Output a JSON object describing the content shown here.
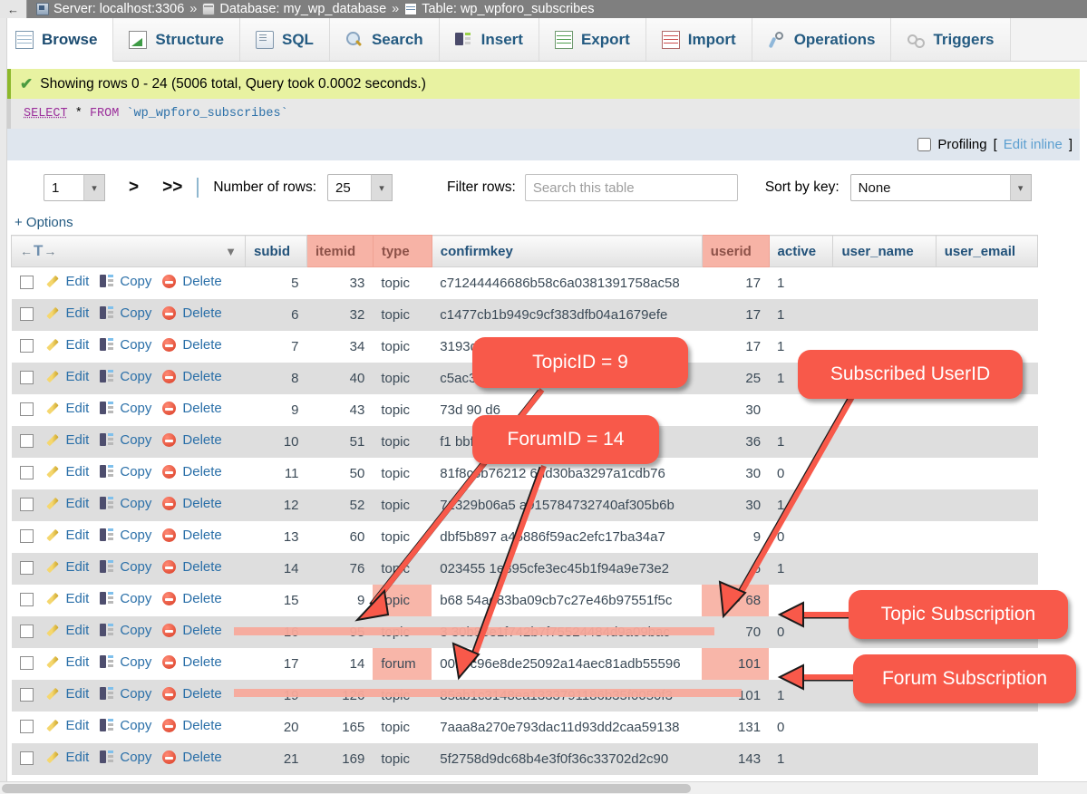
{
  "breadcrumb": {
    "back_icon": "back-arrow-icon",
    "server_icon": "server-icon",
    "server": "Server: localhost:3306",
    "sep1": "»",
    "database_icon": "database-icon",
    "database": "Database: my_wp_database",
    "sep2": "»",
    "table_icon": "table-icon",
    "table": "Table: wp_wpforo_subscribes"
  },
  "tabs": [
    {
      "label": "Browse",
      "icon": "browse-icon",
      "active": true
    },
    {
      "label": "Structure",
      "icon": "structure-icon",
      "active": false
    },
    {
      "label": "SQL",
      "icon": "sql-icon",
      "active": false
    },
    {
      "label": "Search",
      "icon": "search-icon",
      "active": false
    },
    {
      "label": "Insert",
      "icon": "insert-icon",
      "active": false
    },
    {
      "label": "Export",
      "icon": "export-icon",
      "active": false
    },
    {
      "label": "Import",
      "icon": "import-icon",
      "active": false
    },
    {
      "label": "Operations",
      "icon": "operations-icon",
      "active": false
    },
    {
      "label": "Triggers",
      "icon": "triggers-icon",
      "active": false
    }
  ],
  "notice": {
    "icon": "green-check-icon",
    "text": "Showing rows 0 - 24 (5006 total, Query took 0.0002 seconds.)"
  },
  "sql": {
    "select": "SELECT",
    "star": "*",
    "from": "FROM",
    "table": "`wp_wpforo_subscribes`"
  },
  "profiling": {
    "label": "Profiling",
    "bracket_open": "[",
    "edit_inline": "Edit inline",
    "bracket_close": "]",
    "checked": false
  },
  "controls": {
    "page_value": "1",
    "next_label": ">",
    "last_label": ">>",
    "rows_label": "Number of rows:",
    "rows_value": "25",
    "filter_label": "Filter rows:",
    "filter_placeholder": "Search this table",
    "filter_value": "",
    "sort_label": "Sort by key:",
    "sort_value": "None",
    "options_label": "+ Options"
  },
  "table": {
    "sort_header_icon": "sort-direction-icon",
    "columns": [
      {
        "name": "subid",
        "highlighted": false
      },
      {
        "name": "itemid",
        "highlighted": true
      },
      {
        "name": "type",
        "highlighted": true
      },
      {
        "name": "confirmkey",
        "highlighted": false
      },
      {
        "name": "userid",
        "highlighted": true
      },
      {
        "name": "active",
        "highlighted": false
      },
      {
        "name": "user_name",
        "highlighted": false
      },
      {
        "name": "user_email",
        "highlighted": false
      }
    ],
    "row_actions": {
      "edit": "Edit",
      "copy": "Copy",
      "delete": "Delete"
    },
    "rows": [
      {
        "subid": "5",
        "itemid": "33",
        "type": "topic",
        "confirmkey": "c71244446686b58c6a0381391758ac58",
        "userid": "17",
        "active": "1",
        "user_name": "",
        "user_email": ""
      },
      {
        "subid": "6",
        "itemid": "32",
        "type": "topic",
        "confirmkey": "c1477cb1b949c9cf383dfb04a1679efe",
        "userid": "17",
        "active": "1",
        "user_name": "",
        "user_email": ""
      },
      {
        "subid": "7",
        "itemid": "34",
        "type": "topic",
        "confirmkey": "3193de",
        "userid": "17",
        "active": "1",
        "user_name": "",
        "user_email": ""
      },
      {
        "subid": "8",
        "itemid": "40",
        "type": "topic",
        "confirmkey": "c5ac3b efed2d4ed2225d296641e356b",
        "userid": "25",
        "active": "1",
        "user_name": "",
        "user_email": ""
      },
      {
        "subid": "9",
        "itemid": "43",
        "type": "topic",
        "confirmkey": "73d 90 d6",
        "userid": "30",
        "active": "",
        "user_name": "",
        "user_email": ""
      },
      {
        "subid": "10",
        "itemid": "51",
        "type": "topic",
        "confirmkey": "f1 bbf77 ",
        "userid": "36",
        "active": "1",
        "user_name": "",
        "user_email": ""
      },
      {
        "subid": "11",
        "itemid": "50",
        "type": "topic",
        "confirmkey": "81f8c6b76212 6dd30ba3297a1cdb76",
        "userid": "30",
        "active": "0",
        "user_name": "",
        "user_email": ""
      },
      {
        "subid": "12",
        "itemid": "52",
        "type": "topic",
        "confirmkey": "71329b06a5 a915784732740af305b6b",
        "userid": "30",
        "active": "1",
        "user_name": "",
        "user_email": ""
      },
      {
        "subid": "13",
        "itemid": "60",
        "type": "topic",
        "confirmkey": "dbf5b897 a45886f59ac2efc17ba34a7",
        "userid": "9",
        "active": "0",
        "user_name": "",
        "user_email": ""
      },
      {
        "subid": "14",
        "itemid": "76",
        "type": "topic",
        "confirmkey": "023455 1e895cfe3ec45b1f94a9e73e2",
        "userid": "6",
        "active": "1",
        "user_name": "",
        "user_email": ""
      },
      {
        "subid": "15",
        "itemid": "9",
        "type": "topic",
        "confirmkey": "b68 54ad83ba09cb7c27e46b97551f5c",
        "userid": "68",
        "active": "",
        "user_name": "",
        "user_email": ""
      },
      {
        "subid": "16",
        "itemid": "95",
        "type": "topic",
        "confirmkey": "3 30b83e1f742b7f75524484d9a09bac",
        "userid": "70",
        "active": "0",
        "user_name": "",
        "user_email": ""
      },
      {
        "subid": "17",
        "itemid": "14",
        "type": "forum",
        "confirmkey": "00bbc96e8de25092a14aec81adb55596",
        "userid": "101",
        "active": "",
        "user_name": "",
        "user_email": ""
      },
      {
        "subid": "19",
        "itemid": "126",
        "type": "topic",
        "confirmkey": "85ab1c3148ea1333791186b35f0050f3",
        "userid": "101",
        "active": "1",
        "user_name": "",
        "user_email": ""
      },
      {
        "subid": "20",
        "itemid": "165",
        "type": "topic",
        "confirmkey": "7aaa8a270e793dac11d93dd2caa59138",
        "userid": "131",
        "active": "0",
        "user_name": "",
        "user_email": ""
      },
      {
        "subid": "21",
        "itemid": "169",
        "type": "topic",
        "confirmkey": "5f2758d9dc68b4e3f0f36c33702d2c90",
        "userid": "143",
        "active": "1",
        "user_name": "",
        "user_email": ""
      }
    ]
  },
  "annotations": [
    {
      "id": "topic-id",
      "label": "TopicID = 9"
    },
    {
      "id": "forum-id",
      "label": "ForumID = 14"
    },
    {
      "id": "subscribed-userid",
      "label": "Subscribed UserID"
    },
    {
      "id": "topic-subscription",
      "label": "Topic Subscription"
    },
    {
      "id": "forum-subscription",
      "label": "Forum Subscription"
    }
  ],
  "colors": {
    "annotation": "#f8594a",
    "highlight": "#f8b6a9",
    "notice_bg": "#e8f2a1",
    "tab_text": "#235a81"
  }
}
